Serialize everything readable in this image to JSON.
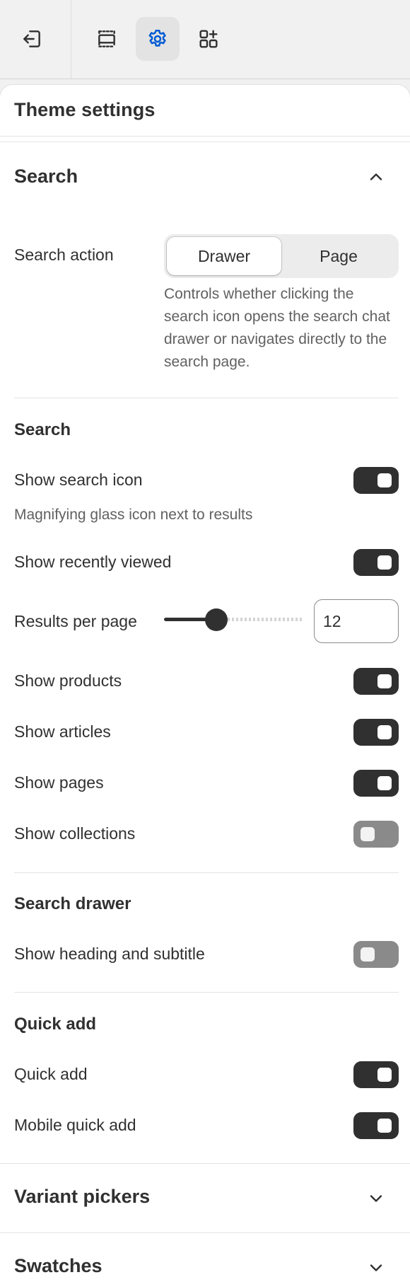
{
  "toolbar": {
    "exit_icon": "exit-icon",
    "sections_icon": "sections-icon",
    "settings_icon": "gear-icon",
    "apps_icon": "apps-add-icon",
    "accent": "#005bd3"
  },
  "panel": {
    "title": "Theme settings"
  },
  "search_section": {
    "title": "Search",
    "expanded": true,
    "search_action": {
      "label": "Search action",
      "options": [
        "Drawer",
        "Page"
      ],
      "selected": "Drawer",
      "help": "Controls whether clicking the search icon opens the search chat drawer or navigates directly to the search page."
    },
    "search_group": {
      "heading": "Search",
      "show_search_icon": {
        "label": "Show search icon",
        "on": true,
        "help": "Magnifying glass icon next to results"
      },
      "show_recently_viewed": {
        "label": "Show recently viewed",
        "on": true
      },
      "results_per_page": {
        "label": "Results per page",
        "value": "12",
        "fraction": 0.35
      },
      "show_products": {
        "label": "Show products",
        "on": true
      },
      "show_articles": {
        "label": "Show articles",
        "on": true
      },
      "show_pages": {
        "label": "Show pages",
        "on": true
      },
      "show_collections": {
        "label": "Show collections",
        "on": false
      }
    },
    "search_drawer": {
      "heading": "Search drawer",
      "show_heading_subtitle": {
        "label": "Show heading and subtitle",
        "on": false
      }
    },
    "quick_add": {
      "heading": "Quick add",
      "quick_add": {
        "label": "Quick add",
        "on": true
      },
      "mobile_quick_add": {
        "label": "Mobile quick add",
        "on": true
      }
    }
  },
  "collapsed_sections": [
    {
      "title": "Variant pickers"
    },
    {
      "title": "Swatches"
    }
  ],
  "colors": {
    "toggle_on": "#303030",
    "toggle_off": "#8a8a8a",
    "text_primary": "#303030",
    "text_secondary": "#616161"
  }
}
